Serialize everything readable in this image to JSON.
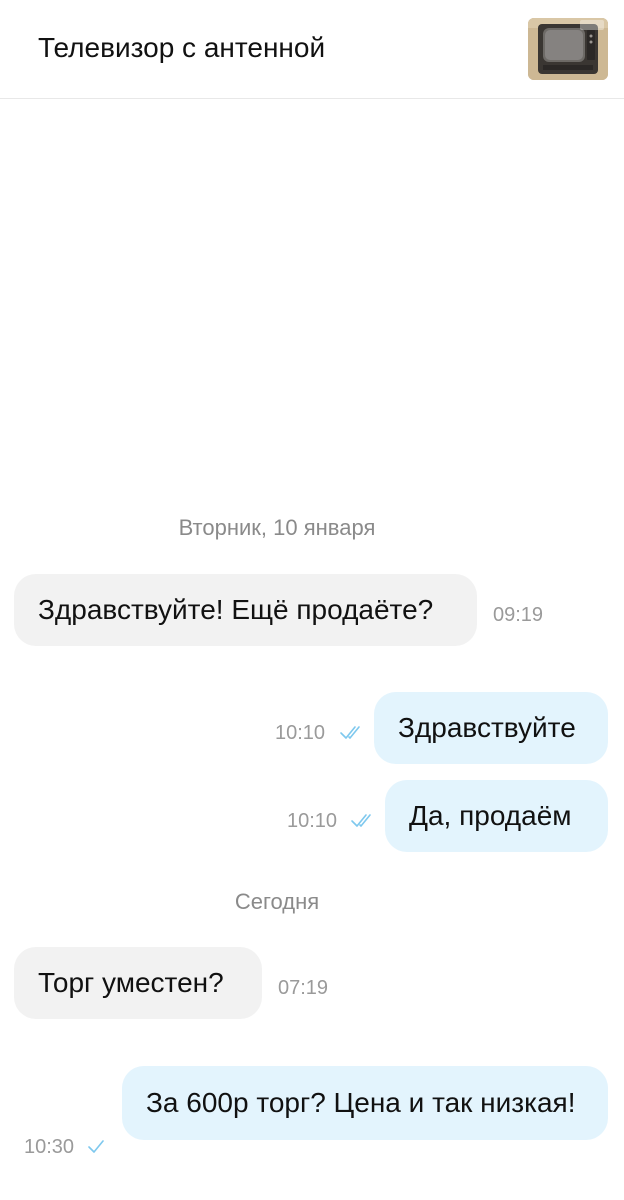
{
  "header": {
    "title": "Телевизор с антенной",
    "thumbnail_icon": "tv-photo"
  },
  "days": [
    {
      "label": "Вторник, 10 января"
    },
    {
      "label": "Сегодня"
    }
  ],
  "messages": [
    {
      "direction": "incoming",
      "text": "Здравствуйте! Ещё продаёте?",
      "time": "09:19"
    },
    {
      "direction": "outgoing",
      "text": "Здравствуйте",
      "time": "10:10",
      "status": "read-double-check"
    },
    {
      "direction": "outgoing",
      "text": "Да, продаём",
      "time": "10:10",
      "status": "read-double-check"
    },
    {
      "direction": "incoming",
      "text": "Торг уместен?",
      "time": "07:19"
    },
    {
      "direction": "outgoing",
      "text": "За 600р торг? Цена и так низкая!",
      "time": "10:30",
      "status": "sent-single-check"
    }
  ],
  "colors": {
    "incoming_bubble": "#f2f2f2",
    "outgoing_bubble": "#e3f4fd",
    "check_mark": "#7ec8ee",
    "secondary_text": "#8a8a8a"
  }
}
